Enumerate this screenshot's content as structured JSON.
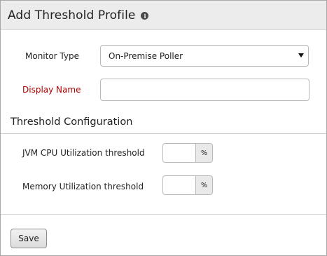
{
  "dialog": {
    "title": "Add Threshold Profile",
    "info_icon": "info-icon"
  },
  "form": {
    "monitor_type": {
      "label": "Monitor Type",
      "selected": "On-Premise Poller"
    },
    "display_name": {
      "label": "Display Name",
      "value": "",
      "required_color": "#b00000"
    }
  },
  "threshold_config": {
    "title": "Threshold Configuration",
    "fields": [
      {
        "label": "JVM CPU Utilization threshold",
        "value": "",
        "unit": "%"
      },
      {
        "label": "Memory Utilization threshold",
        "value": "",
        "unit": "%"
      }
    ]
  },
  "footer": {
    "save_label": "Save"
  }
}
